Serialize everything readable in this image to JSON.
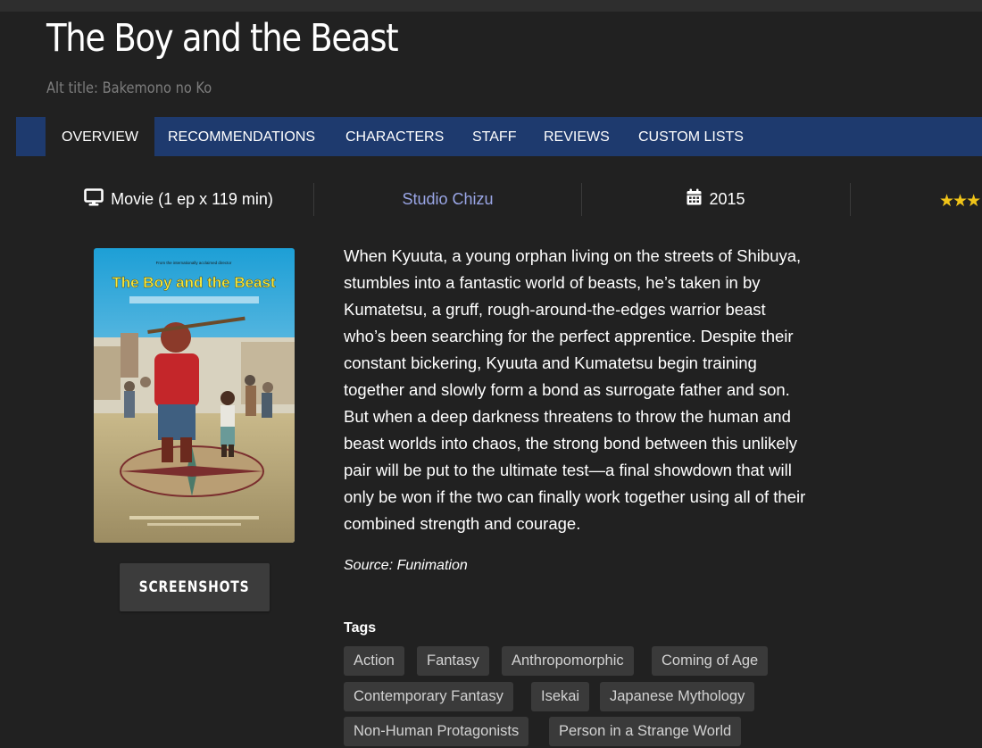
{
  "header": {
    "title": "The Boy and the Beast",
    "alt_title": "Alt title: Bakemono no Ko"
  },
  "tabs": [
    {
      "label": "OVERVIEW",
      "active": true
    },
    {
      "label": "RECOMMENDATIONS",
      "active": false
    },
    {
      "label": "CHARACTERS",
      "active": false
    },
    {
      "label": "STAFF",
      "active": false
    },
    {
      "label": "REVIEWS",
      "active": false
    },
    {
      "label": "CUSTOM LISTS",
      "active": false
    }
  ],
  "info": {
    "type": "Movie (1 ep x 119 min)",
    "type_icon": "monitor-icon",
    "studio": "Studio Chizu",
    "year": "2015",
    "year_icon": "calendar-icon",
    "rating_icon": "star-icon"
  },
  "poster": {
    "title_text": "The Boy and the Beast"
  },
  "screenshots_label": "SCREENSHOTS",
  "synopsis": {
    "lines": [
      "When Kyuuta, a young orphan living on the streets of Shibuya,",
      "stumbles into a fantastic world of beasts, he’s taken in by",
      "Kumatetsu, a gruff, rough-around-the-edges warrior beast",
      "who’s been searching for the perfect apprentice. Despite their",
      "constant bickering, Kyuuta and Kumatetsu begin training",
      "together and slowly form a bond as surrogate father and son.",
      "But when a deep darkness threatens to throw the human and",
      "beast worlds into chaos, the strong bond between this unlikely",
      "pair will be put to the ultimate test—a final showdown that will",
      "only be won if the two can finally work together using all of their",
      "combined strength and courage."
    ],
    "source": "Source: Funimation"
  },
  "tags": {
    "label": "Tags",
    "items": [
      "Action",
      "Fantasy",
      "Anthropomorphic",
      "Coming of Age",
      "Contemporary Fantasy",
      "Isekai",
      "Japanese Mythology",
      "Non-Human Protagonists",
      "Person in a Strange World"
    ]
  },
  "colors": {
    "background": "#212121",
    "tab_bar": "#1e3a6e",
    "studio_link": "#9aa6e6",
    "star": "#f0c419",
    "tag_bg": "#3a3a3a"
  }
}
